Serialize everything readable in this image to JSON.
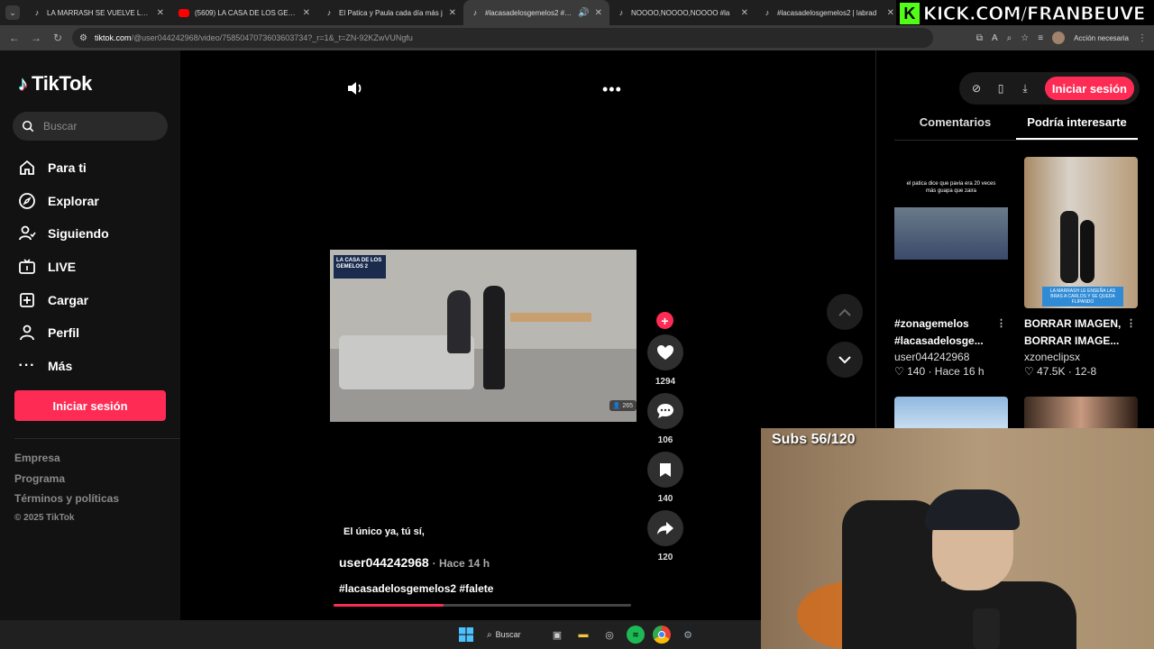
{
  "browser": {
    "tabs": [
      {
        "title": "LA MARRASH SE VUELVE LOCA",
        "favicon": "tiktok-icon",
        "active": false
      },
      {
        "title": "(5609) LA CASA DE LOS GEMELOS",
        "favicon": "youtube-icon",
        "active": false
      },
      {
        "title": "El Patica y Paula cada día más j",
        "favicon": "tiktok-icon",
        "active": false
      },
      {
        "title": "#lacasadelosgemelos2 #fale",
        "favicon": "tiktok-icon",
        "active": true,
        "audio": true
      },
      {
        "title": "NOOOO,NOOOO,NOOOO #la",
        "favicon": "tiktok-icon",
        "active": false
      },
      {
        "title": "#lacasadelosgemelos2 | labrad",
        "favicon": "tiktok-icon",
        "active": false
      }
    ],
    "url_host": "tiktok.com",
    "url_path": "/@user044242968/video/7585047073603603734?_r=1&_t=ZN-92KZwVUNgfu",
    "account_status": "Acción necesaria"
  },
  "overlay": {
    "kick_text": "KICK.COM/FRANBEUVE",
    "subs_text": "Subs 56/120"
  },
  "tiktok": {
    "logo_text": "TikTok",
    "search_placeholder": "Buscar",
    "nav": [
      {
        "label": "Para ti",
        "icon": "home-icon"
      },
      {
        "label": "Explorar",
        "icon": "compass-icon"
      },
      {
        "label": "Siguiendo",
        "icon": "following-icon"
      },
      {
        "label": "LIVE",
        "icon": "live-icon"
      },
      {
        "label": "Cargar",
        "icon": "upload-icon"
      },
      {
        "label": "Perfil",
        "icon": "profile-icon"
      },
      {
        "label": "Más",
        "icon": "more-icon"
      }
    ],
    "login_label": "Iniciar sesión",
    "footer": [
      "Empresa",
      "Programa",
      "Términos y políticas"
    ],
    "copyright": "© 2025 TikTok"
  },
  "video": {
    "overlay_title": "LA CASA DE LOS GEMELOS 2",
    "views_badge": "265",
    "caption": "El único ya, tú sí,",
    "author": "user044242968",
    "time": "· Hace 14 h",
    "hashtags": "#lacasadelosgemelos2 #falete",
    "progress": 0.37,
    "likes": "1294",
    "comments": "106",
    "saves": "140",
    "shares": "120"
  },
  "right_panel": {
    "login_label": "Iniciar sesión",
    "tabs": [
      "Comentarios",
      "Podría interesarte"
    ],
    "active_tab": 1,
    "cards": [
      {
        "thumb_text": "el patica dice que pavia era 20 veces más guapa que zaira",
        "caption": "#zonagemelos #lacasadelosge...",
        "user": "user044242968",
        "likes": "140",
        "time": "Hace 16 h"
      },
      {
        "thumb_text": "LA MARRASH LE ENSEÑA LAS BRAS A CARLOS Y SE QUEDA FLIPANDO",
        "caption": "BORRAR IMAGEN, BORRAR IMAGE...",
        "user": "xzoneclipsx",
        "likes": "47.5K",
        "time": "12-8"
      }
    ]
  },
  "taskbar": {
    "search_label": "Buscar"
  },
  "colors": {
    "tiktok_red": "#fe2c55",
    "kick_green": "#53fc18"
  }
}
